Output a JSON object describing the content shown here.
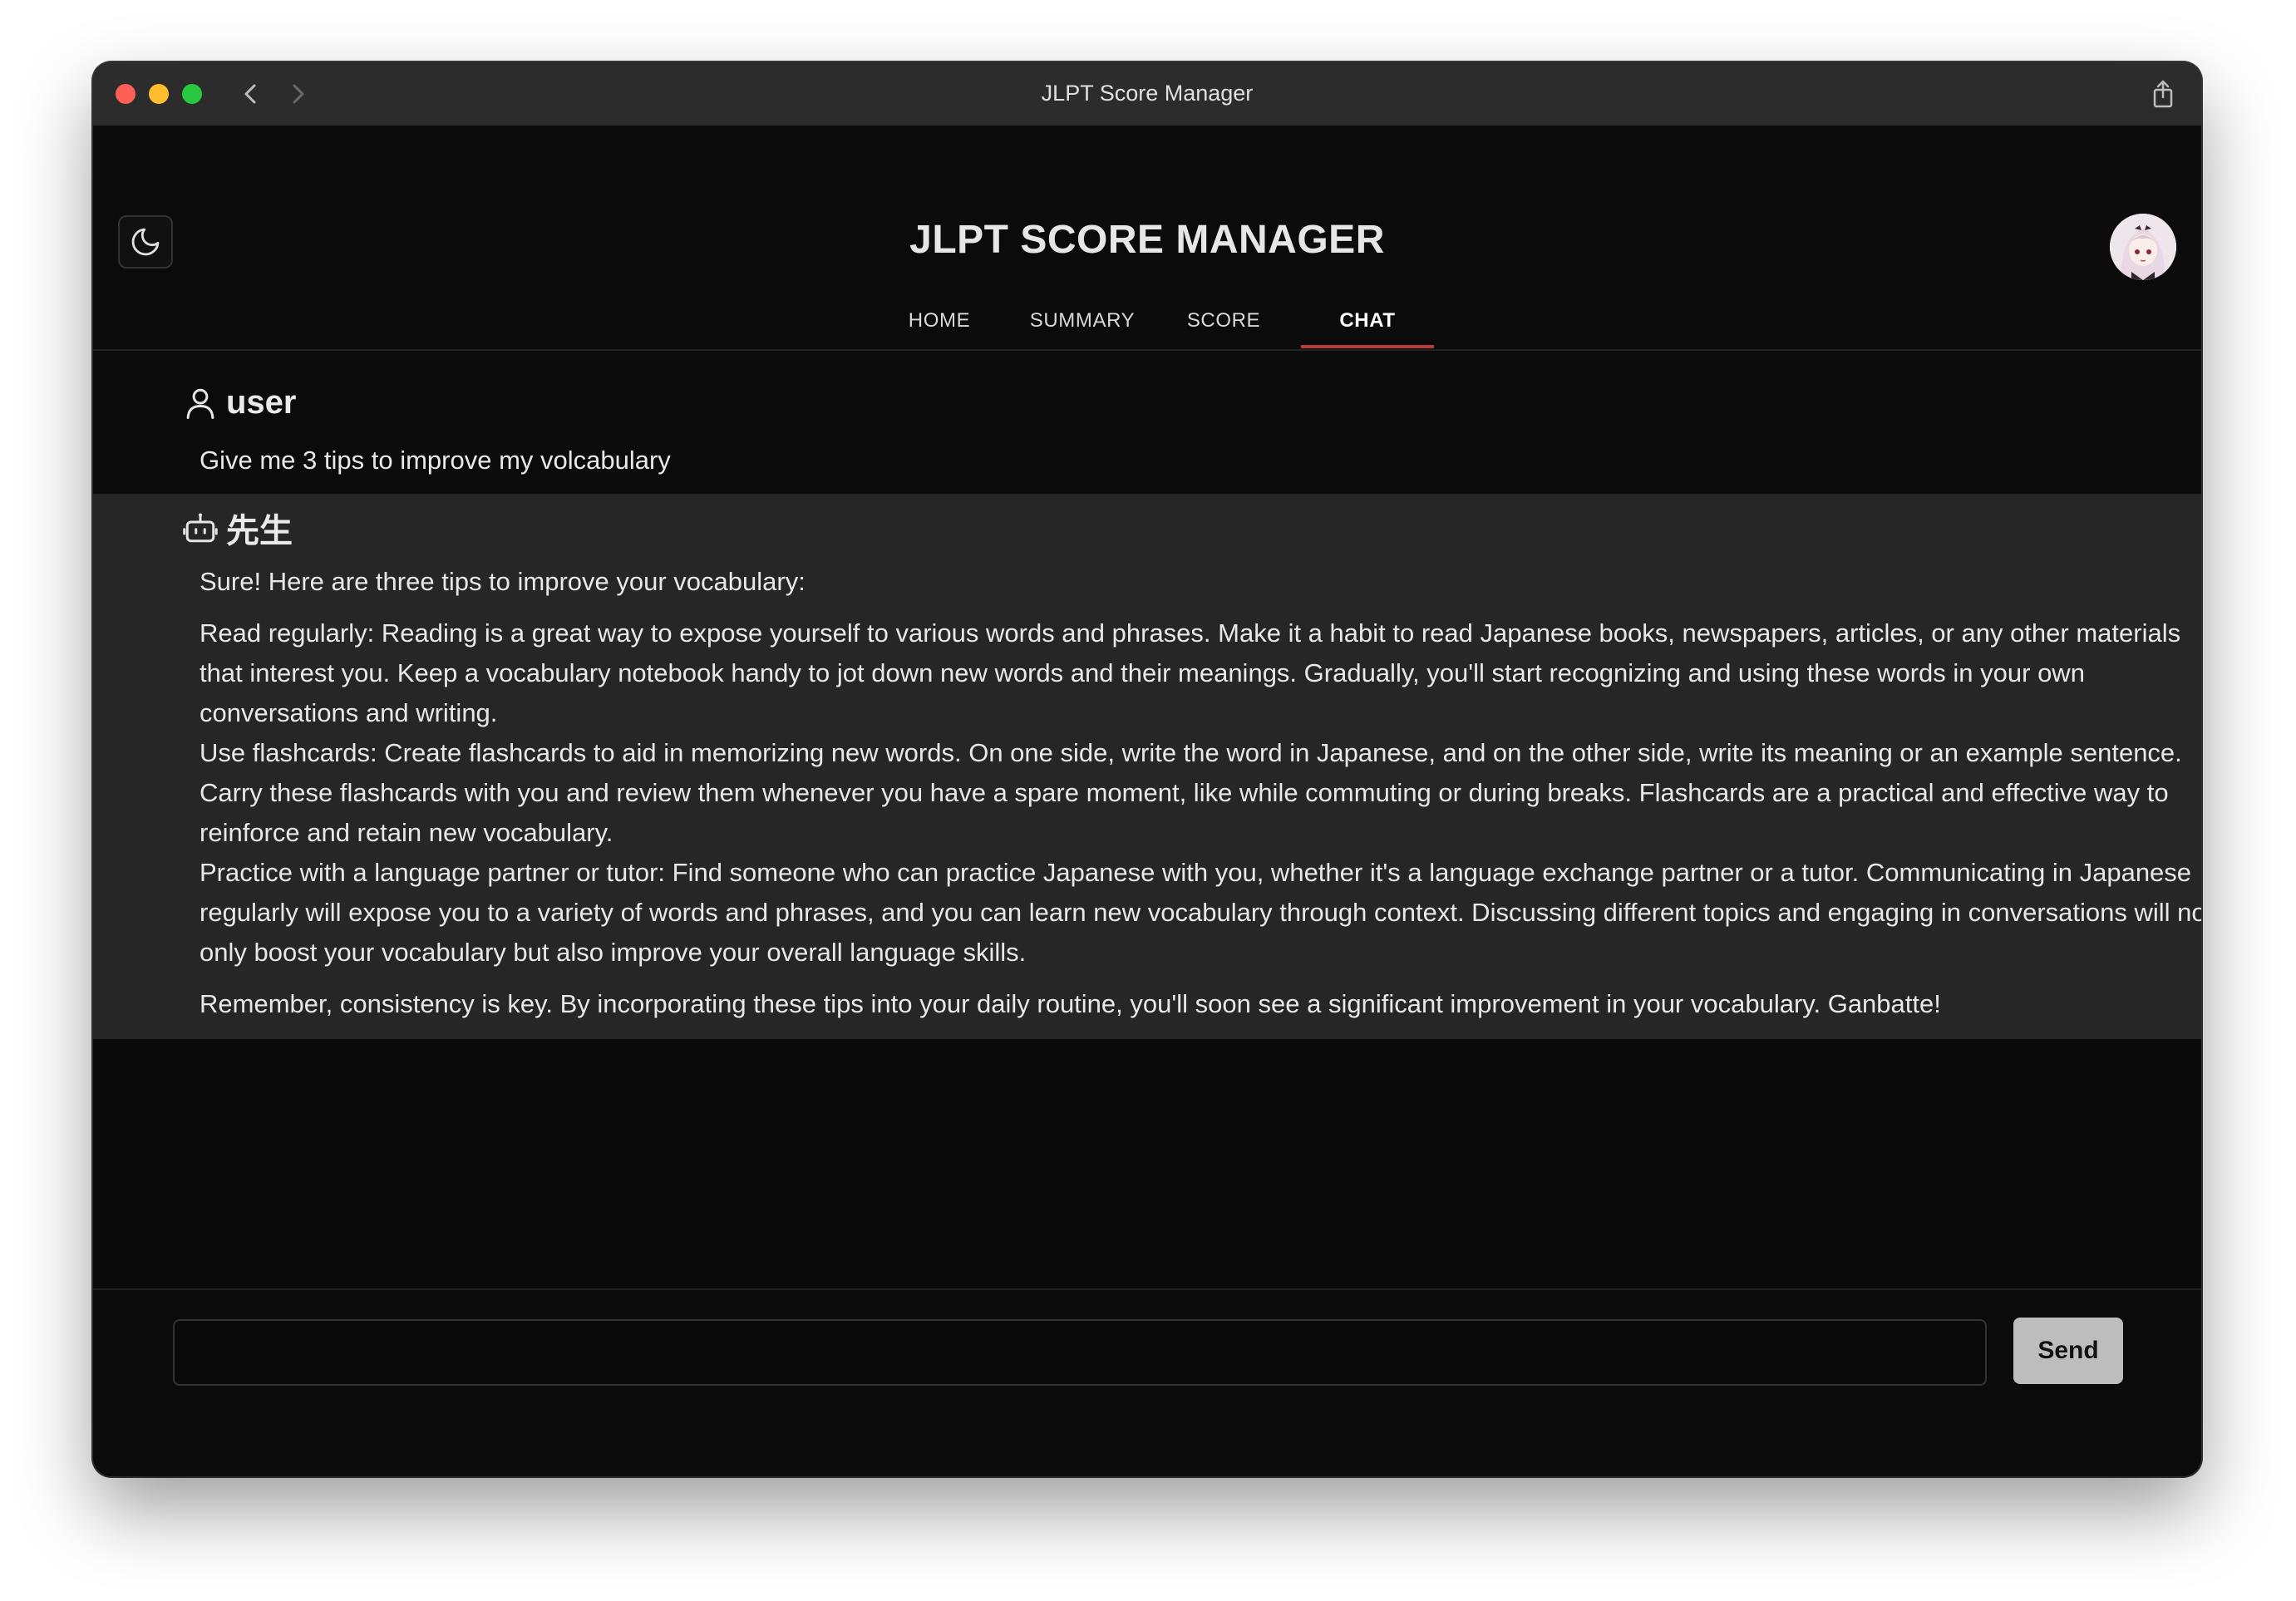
{
  "window": {
    "title": "JLPT Score Manager"
  },
  "header": {
    "app_title": "JLPT SCORE MANAGER",
    "theme_toggle_icon": "moon-icon",
    "avatar_icon": "anime-avatar"
  },
  "tabs": [
    {
      "label": "HOME",
      "active": false
    },
    {
      "label": "SUMMARY",
      "active": false
    },
    {
      "label": "SCORE",
      "active": false
    },
    {
      "label": "CHAT",
      "active": true
    }
  ],
  "messages": {
    "user": {
      "sender": "user",
      "icon": "person-icon",
      "text": "Give me 3 tips to improve my volcabulary"
    },
    "bot": {
      "sender": "先生",
      "icon": "robot-icon",
      "intro": "Sure! Here are three tips to improve your vocabulary:",
      "tips": [
        "Read regularly: Reading is a great way to expose yourself to various words and phrases. Make it a habit to read Japanese books, newspapers, articles, or any other materials that interest you. Keep a vocabulary notebook handy to jot down new words and their meanings. Gradually, you'll start recognizing and using these words in your own conversations and writing.",
        "Use flashcards: Create flashcards to aid in memorizing new words. On one side, write the word in Japanese, and on the other side, write its meaning or an example sentence. Carry these flashcards with you and review them whenever you have a spare moment, like while commuting or during breaks. Flashcards are a practical and effective way to reinforce and retain new vocabulary.",
        "Practice with a language partner or tutor: Find someone who can practice Japanese with you, whether it's a language exchange partner or a tutor. Communicating in Japanese regularly will expose you to a variety of words and phrases, and you can learn new vocabulary through context. Discussing different topics and engaging in conversations will not only boost your vocabulary but also improve your overall language skills."
      ],
      "outro": "Remember, consistency is key. By incorporating these tips into your daily routine, you'll soon see a significant improvement in your vocabulary. Ganbatte!"
    }
  },
  "input": {
    "value": "",
    "placeholder": "",
    "send_label": "Send"
  },
  "colors": {
    "background": "#0a0a0a",
    "bot_message_bg": "#262626",
    "active_tab_underline": "#b63a3a",
    "send_button": "#bdbdbd"
  }
}
